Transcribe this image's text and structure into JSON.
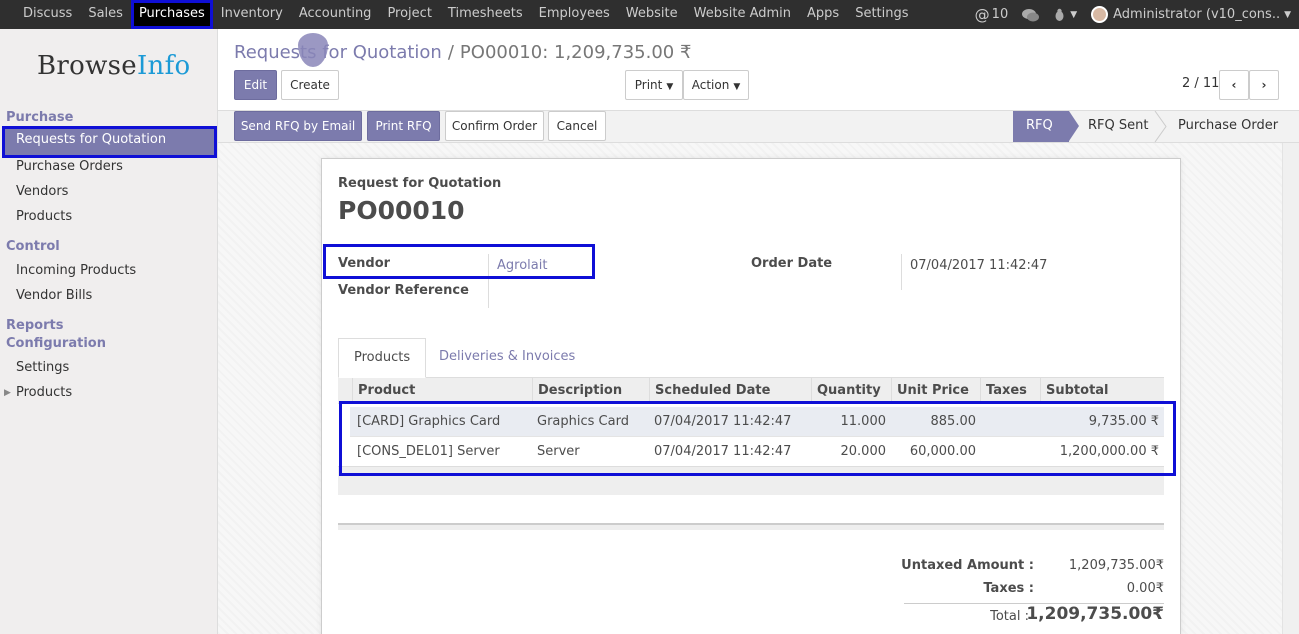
{
  "topnav": {
    "items": [
      "Discuss",
      "Sales",
      "Purchases",
      "Inventory",
      "Accounting",
      "Project",
      "Timesheets",
      "Employees",
      "Website",
      "Website Admin",
      "Apps",
      "Settings"
    ],
    "mentions": "10",
    "user": "Administrator (v10_cons.."
  },
  "sidebar": {
    "logo_part1": "Browse",
    "logo_part2": "Info",
    "section_purchase": "Purchase",
    "item_rfq": "Requests for Quotation",
    "item_po": "Purchase Orders",
    "item_vendors": "Vendors",
    "item_products": "Products",
    "section_control": "Control",
    "item_incoming": "Incoming Products",
    "item_bills": "Vendor Bills",
    "section_reports": "Reports",
    "section_config": "Configuration",
    "item_settings": "Settings",
    "item_products2": "Products"
  },
  "breadcrumb": {
    "parent": "Requests for Quotation",
    "separator": "/",
    "current": "PO00010: 1,209,735.00 ₹"
  },
  "toolbar": {
    "edit": "Edit",
    "create": "Create",
    "print": "Print",
    "action": "Action",
    "pager": "2 / 11",
    "prev_icon": "chevron-left",
    "next_icon": "chevron-right"
  },
  "statusbar": {
    "send_rfq": "Send RFQ by Email",
    "print_rfq": "Print RFQ",
    "confirm": "Confirm Order",
    "cancel": "Cancel",
    "stages": [
      "RFQ",
      "RFQ Sent",
      "Purchase Order"
    ]
  },
  "form": {
    "subtitle": "Request for Quotation",
    "name": "PO00010",
    "vendor_label": "Vendor",
    "vendor_value": "Agrolait",
    "vendor_ref_label": "Vendor Reference",
    "order_date_label": "Order Date",
    "order_date_value": "07/04/2017 11:42:47"
  },
  "tabs": [
    "Products",
    "Deliveries & Invoices"
  ],
  "table": {
    "headers": [
      "Product",
      "Description",
      "Scheduled Date",
      "Quantity",
      "Unit Price",
      "Taxes",
      "Subtotal"
    ],
    "rows": [
      [
        "[CARD] Graphics Card",
        "Graphics Card",
        "07/04/2017 11:42:47",
        "11.000",
        "885.00",
        "",
        "9,735.00 ₹"
      ],
      [
        "[CONS_DEL01] Server",
        "Server",
        "07/04/2017 11:42:47",
        "20.000",
        "60,000.00",
        "",
        "1,200,000.00 ₹"
      ]
    ]
  },
  "totals": {
    "untaxed_label": "Untaxed Amount :",
    "untaxed_value": "1,209,735.00₹",
    "taxes_label": "Taxes :",
    "taxes_value": "0.00₹",
    "total_label": "Total :",
    "total_value": "1,209,735.00₹"
  },
  "colors": {
    "accent": "#7c7bad",
    "highlight_box": "#0f0fd6",
    "navbar": "#2f2f2f"
  }
}
